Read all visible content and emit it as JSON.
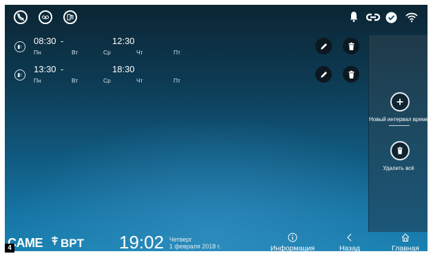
{
  "status_bar": {
    "left_icons": [
      "mute-icon",
      "voicemail-icon",
      "door-entry-icon"
    ],
    "right_icons": [
      "bell-icon",
      "link-icon",
      "check-circle-icon",
      "wifi-icon"
    ]
  },
  "schedules": [
    {
      "start": "08:30",
      "separator": "-",
      "end": "12:30",
      "days": [
        "Пн",
        "Вт",
        "Ср",
        "Чт",
        "Пт"
      ]
    },
    {
      "start": "13:30",
      "separator": "-",
      "end": "18:30",
      "days": [
        "Пн",
        "Вт",
        "Ср",
        "Чт",
        "Пт"
      ]
    }
  ],
  "side_panel": {
    "new_interval_label": "Новый интервал времени",
    "delete_all_label": "Удалить всё"
  },
  "footer": {
    "brand_left": "CAME",
    "brand_right": "BPT",
    "time": "19:02",
    "weekday": "Четверг",
    "date": "1 февраля 2018 г.",
    "nav": {
      "info_label": "Информация",
      "back_label": "Назад",
      "home_label": "Главная"
    }
  },
  "page_number": "4"
}
